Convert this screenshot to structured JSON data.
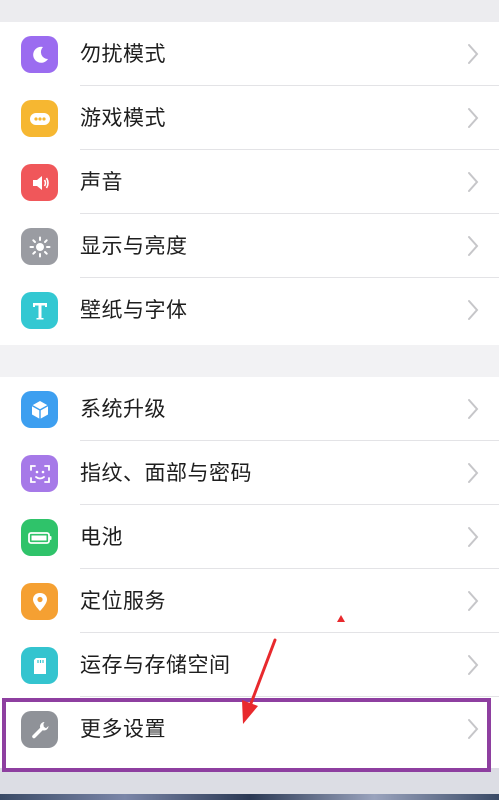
{
  "settings": {
    "group1": [
      {
        "label": "勿扰模式",
        "icon": "moon-icon",
        "color": "#9b6cf0"
      },
      {
        "label": "游戏模式",
        "icon": "gamepad-icon",
        "color": "#f6b731"
      },
      {
        "label": "声音",
        "icon": "speaker-icon",
        "color": "#f0575a"
      },
      {
        "label": "显示与亮度",
        "icon": "brightness-icon",
        "color": "#9a9ca2"
      },
      {
        "label": "壁纸与字体",
        "icon": "text-t-icon",
        "color": "#33c8d2"
      }
    ],
    "group2": [
      {
        "label": "系统升级",
        "icon": "system-update-icon",
        "color": "#3d9ff0"
      },
      {
        "label": "指纹、面部与密码",
        "icon": "fingerprint-face-icon",
        "color": "#a679e8"
      },
      {
        "label": "电池",
        "icon": "battery-icon",
        "color": "#2fc36a"
      },
      {
        "label": "定位服务",
        "icon": "location-pin-icon",
        "color": "#f5a032"
      },
      {
        "label": "运存与存储空间",
        "icon": "sd-card-icon",
        "color": "#34c4cf"
      },
      {
        "label": "更多设置",
        "icon": "wrench-icon",
        "color": "#8f9298"
      }
    ]
  },
  "annotation": {
    "highlight_color": "#8e3fa0",
    "arrow_color": "#e8292d"
  }
}
